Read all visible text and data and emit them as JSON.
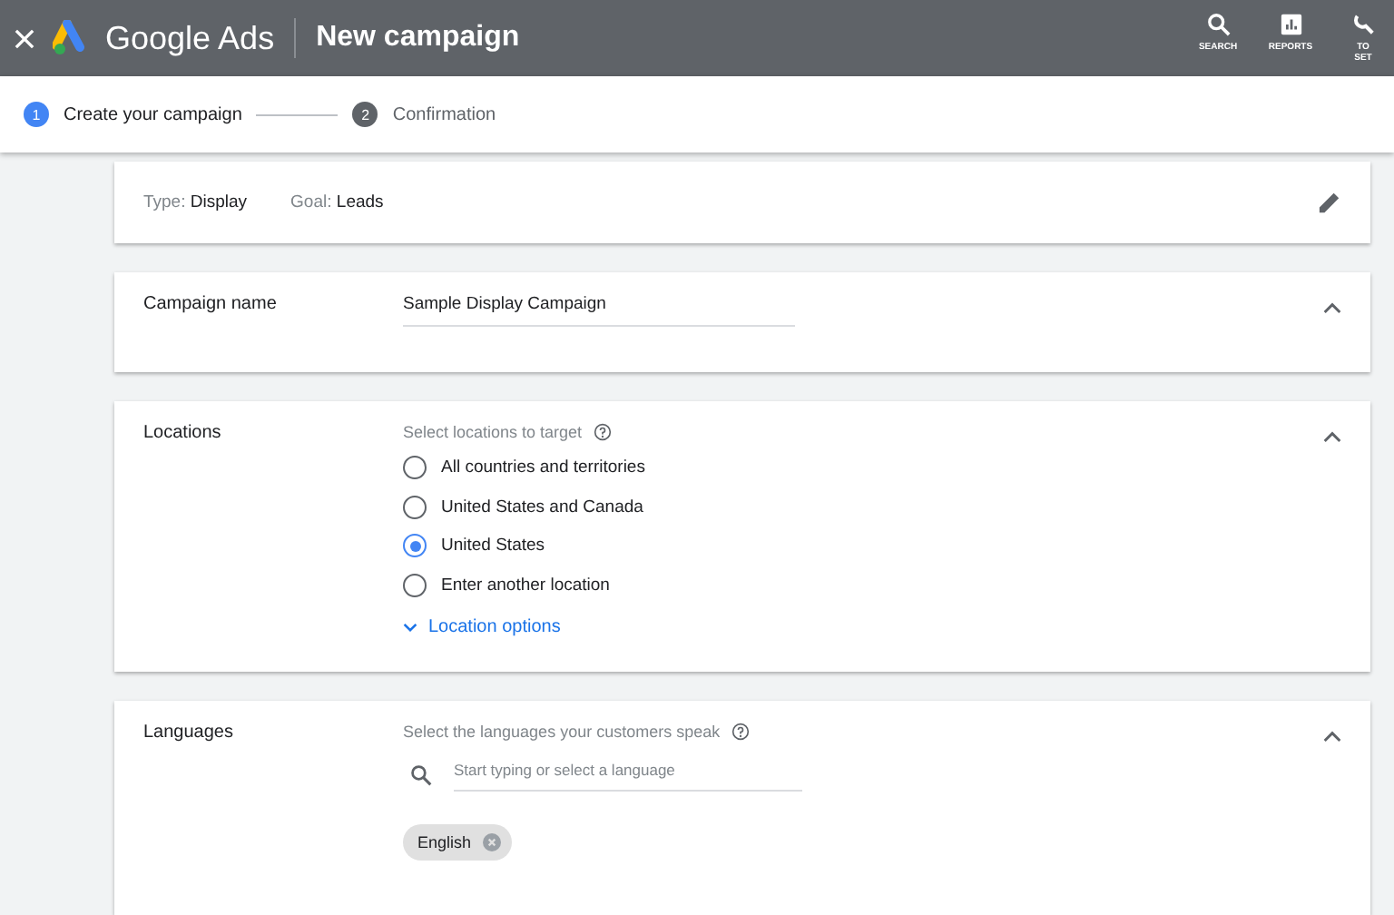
{
  "header": {
    "product": "Google Ads",
    "title": "New campaign",
    "actions": [
      {
        "kind": "search",
        "label": [
          "SEARCH"
        ]
      },
      {
        "kind": "reports",
        "label": [
          "REPORTS"
        ]
      },
      {
        "kind": "tools",
        "label": [
          "TO",
          "SET"
        ]
      }
    ]
  },
  "steps": [
    {
      "number": "1",
      "label": "Create your campaign",
      "selected": true
    },
    {
      "number": "2",
      "label": "Confirmation",
      "selected": false
    }
  ],
  "summary": {
    "type_label": "Type:",
    "type_value": "Display",
    "goal_label": "Goal:",
    "goal_value": "Leads"
  },
  "campaign_name": {
    "label": "Campaign name",
    "value": "Sample Display Campaign"
  },
  "locations": {
    "label": "Locations",
    "prompt": "Select locations to target",
    "options": [
      {
        "label": "All countries and territories",
        "selected": false
      },
      {
        "label": "United States and Canada",
        "selected": false
      },
      {
        "label": "United States",
        "selected": true
      },
      {
        "label": "Enter another location",
        "selected": false
      }
    ],
    "more_link": "Location options"
  },
  "languages": {
    "label": "Languages",
    "prompt": "Select the languages your customers speak",
    "placeholder": "Start typing or select a language",
    "chips": [
      "English"
    ]
  }
}
